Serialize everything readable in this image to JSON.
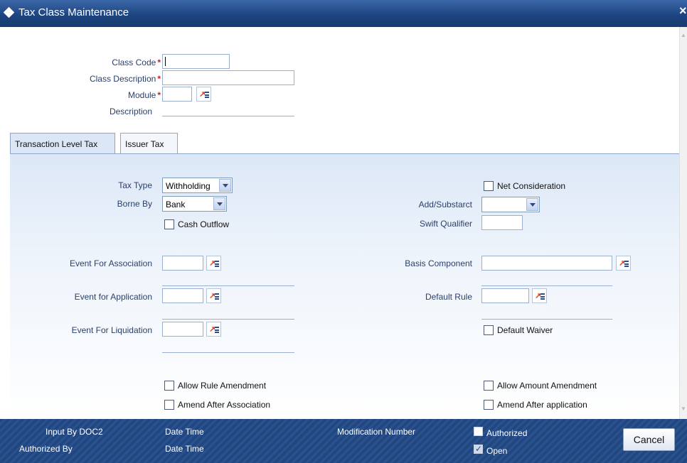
{
  "window": {
    "title": "Tax Class Maintenance",
    "close_glyph": "×"
  },
  "header_fields": {
    "class_code": {
      "label": "Class Code",
      "value": ""
    },
    "class_description": {
      "label": "Class Description",
      "value": ""
    },
    "module": {
      "label": "Module",
      "value": ""
    },
    "description": {
      "label": "Description",
      "value": ""
    },
    "required_marker": "*"
  },
  "tabs": [
    {
      "label": "Transaction Level Tax",
      "active": true
    },
    {
      "label": "Issuer Tax",
      "active": false
    }
  ],
  "form": {
    "tax_type": {
      "label": "Tax Type",
      "value": "Withholding"
    },
    "borne_by": {
      "label": "Borne By",
      "value": "Bank"
    },
    "cash_outflow": {
      "label": "Cash Outflow",
      "checked": false
    },
    "net_consideration": {
      "label": "Net Consideration",
      "checked": false
    },
    "add_substract": {
      "label": "Add/Substarct",
      "value": ""
    },
    "swift_qualifier": {
      "label": "Swift Qualifier",
      "value": ""
    },
    "event_for_association": {
      "label": "Event For Association",
      "value": ""
    },
    "event_for_application": {
      "label": "Event for Application",
      "value": ""
    },
    "event_for_liquidation": {
      "label": "Event For Liquidation",
      "value": ""
    },
    "basis_component": {
      "label": "Basis Component",
      "value": ""
    },
    "default_rule": {
      "label": "Default Rule",
      "value": ""
    },
    "default_waiver": {
      "label": "Default Waiver",
      "checked": false
    },
    "allow_rule_amendment": {
      "label": "Allow Rule Amendment",
      "checked": false
    },
    "amend_after_association": {
      "label": "Amend After Association",
      "checked": false
    },
    "allow_amount_amendment": {
      "label": "Allow Amount Amendment",
      "checked": false
    },
    "amend_after_application": {
      "label": "Amend After application",
      "checked": false
    }
  },
  "footer": {
    "input_by": "Input By DOC2",
    "authorized_by": "Authorized By",
    "date_time_1": "Date Time",
    "date_time_2": "Date Time",
    "modification_number": "Modification Number",
    "authorized": {
      "label": "Authorized",
      "checked": false
    },
    "open": {
      "label": "Open",
      "checked": true
    },
    "cancel_label": "Cancel"
  },
  "colors": {
    "title_bar": "#1e4581",
    "footer": "#22477f",
    "label_text": "#2a3f6a",
    "required_marker": "#d01c1c",
    "panel_top": "#dce8f7"
  },
  "icons": {
    "list_of_values": "lov-icon",
    "dropdown": "chevron-down-icon",
    "title": "diamond-icon"
  }
}
